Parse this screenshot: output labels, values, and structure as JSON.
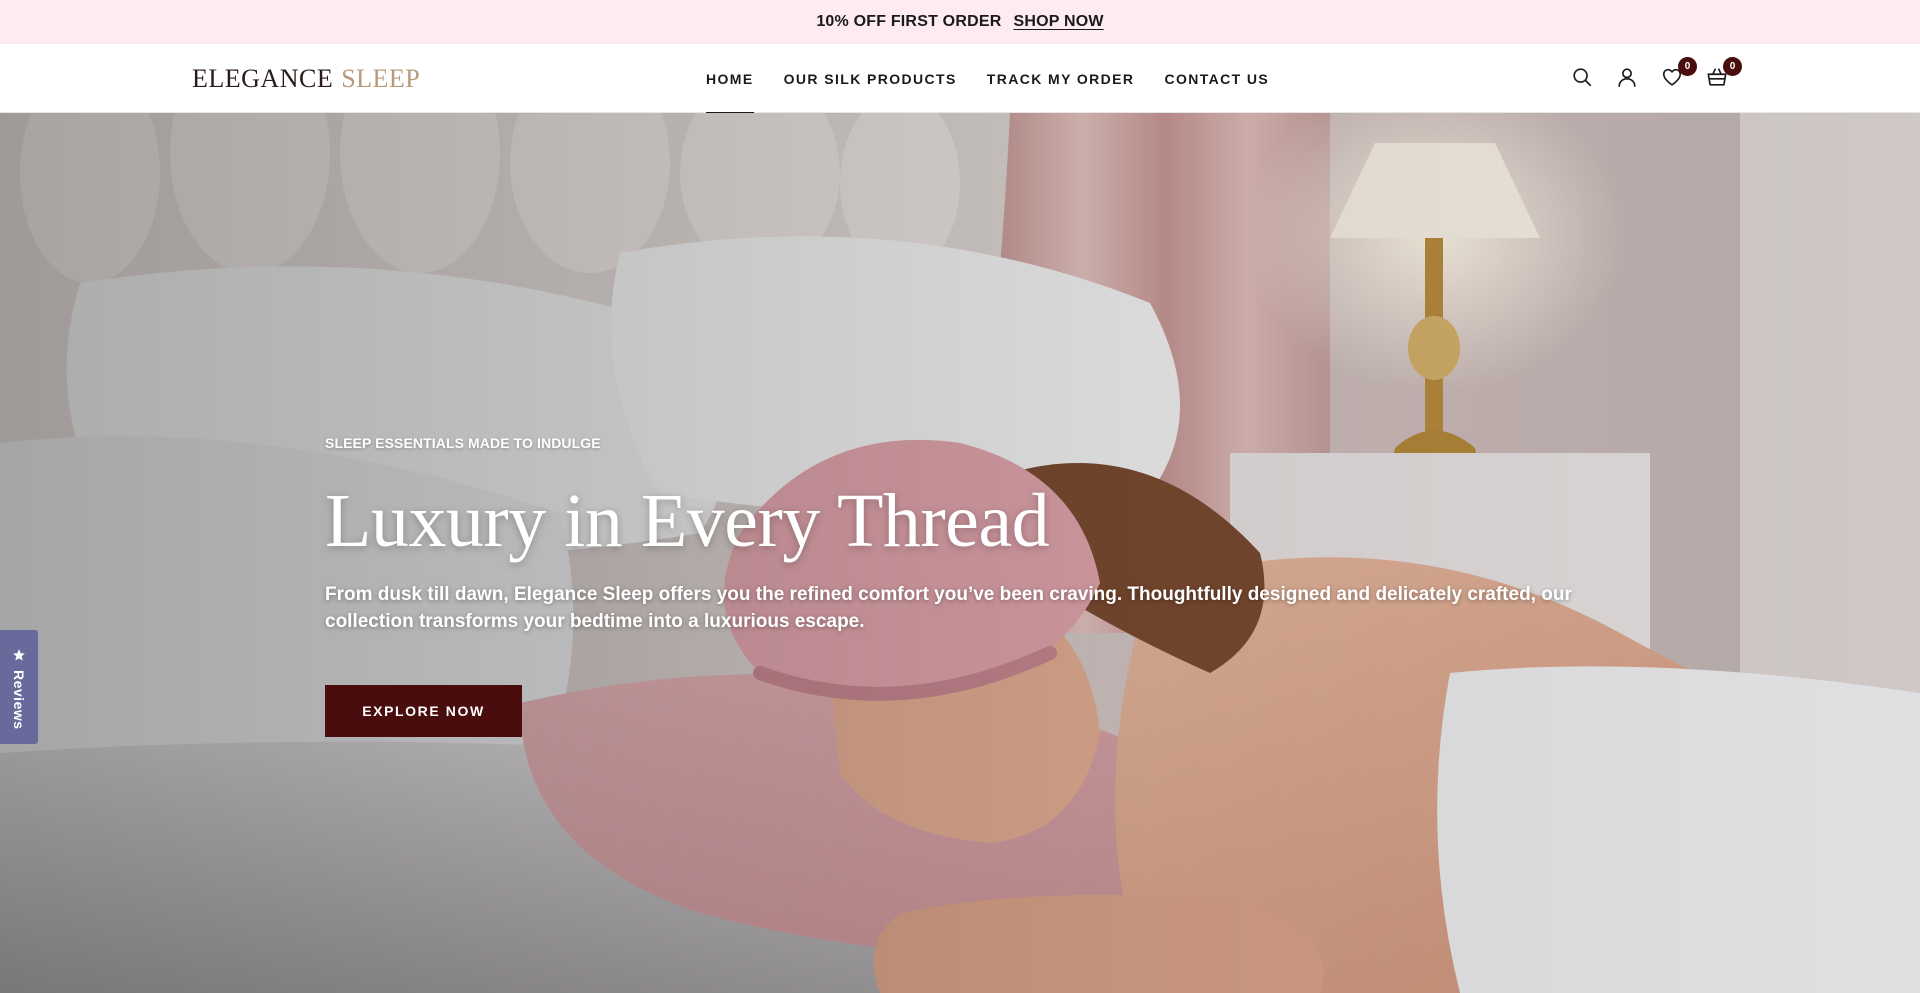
{
  "announcement": {
    "text": "10% OFF FIRST ORDER",
    "link_label": "SHOP NOW"
  },
  "header": {
    "logo_part1": "ELEGANCE",
    "logo_part2": "SLEEP",
    "nav": [
      {
        "label": "HOME",
        "active": true
      },
      {
        "label": "OUR SILK PRODUCTS",
        "active": false
      },
      {
        "label": "TRACK MY ORDER",
        "active": false
      },
      {
        "label": "CONTACT US",
        "active": false
      }
    ],
    "icons": {
      "search": "search-icon",
      "account": "user-icon",
      "wishlist": "heart-icon",
      "cart": "basket-icon"
    },
    "wishlist_count": "0",
    "cart_count": "0"
  },
  "hero": {
    "eyebrow": "SLEEP ESSENTIALS MADE TO INDULGE",
    "title": "Luxury in Every Thread",
    "description": "From dusk till dawn, Elegance Sleep offers you the refined comfort you’ve been craving. Thoughtfully designed and delicately crafted, our collection transforms your bedtime into a luxurious escape.",
    "cta_label": "EXPLORE NOW"
  },
  "reviews_tab": {
    "label": "Reviews",
    "icon": "star-icon"
  },
  "colors": {
    "announcement_bg": "#fdebf1",
    "brand_dark": "#4a0d0d",
    "logo_accent": "#b89a7a",
    "reviews_tab_bg": "#676a9a"
  }
}
